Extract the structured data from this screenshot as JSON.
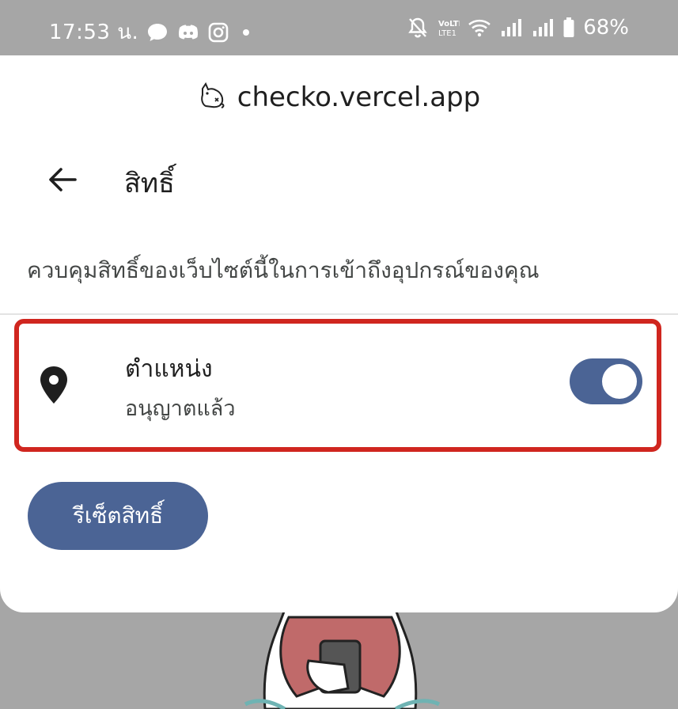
{
  "status_bar": {
    "time": "17:53 น.",
    "battery": "68%",
    "icons_left": [
      "chat-bubble-icon",
      "discord-icon",
      "instagram-icon",
      "dot-icon"
    ],
    "icons_right": [
      "bell-off-icon",
      "volte-icon",
      "wifi-icon",
      "signal-icon",
      "signal-icon",
      "battery-icon"
    ]
  },
  "header": {
    "site_icon": "cat-favicon-icon",
    "site_url": "checko.vercel.app"
  },
  "page": {
    "title": "สิทธิ์",
    "description": "ควบคุมสิทธิ์ของเว็บไซต์นี้ในการเข้าถึงอุปกรณ์ของคุณ"
  },
  "permissions": [
    {
      "icon": "location-pin-icon",
      "title": "ตำแหน่ง",
      "status": "อนุญาตแล้ว",
      "enabled": true
    }
  ],
  "actions": {
    "reset_label": "รีเซ็ตสิทธิ์"
  },
  "colors": {
    "accent": "#4b6495",
    "highlight_border": "#d0261f",
    "scrim": "#a6a6a6"
  }
}
